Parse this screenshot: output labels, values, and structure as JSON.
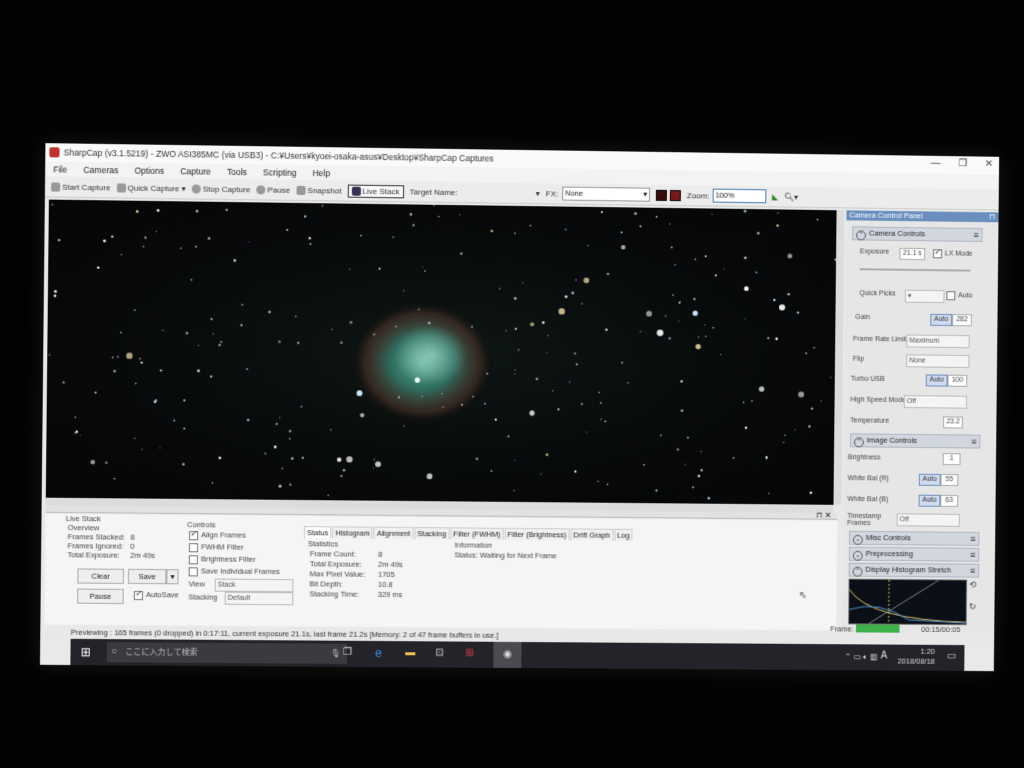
{
  "window": {
    "title": "SharpCap (v3.1.5219) - ZWO ASI385MC (via USB3) - C:¥Users¥kyoei-osaka-asus¥Desktop¥SharpCap Captures",
    "controls": [
      "—",
      "❐",
      "✕"
    ]
  },
  "menu": [
    "File",
    "Cameras",
    "Options",
    "Capture",
    "Tools",
    "Scripting",
    "Help"
  ],
  "toolbar": {
    "start_capture": "Start Capture",
    "quick_capture": "Quick Capture",
    "stop_capture": "Stop Capture",
    "pause": "Pause",
    "snapshot": "Snapshot",
    "live_stack": "Live Stack",
    "target_name_label": "Target Name:",
    "fx_label": "FX:",
    "fx_value": "None",
    "zoom_label": "Zoom:",
    "zoom_value": "100%"
  },
  "live_stack": {
    "title": "Live Stack",
    "overview_label": "Overview",
    "frames_stacked_label": "Frames Stacked:",
    "frames_stacked": "8",
    "frames_ignored_label": "Frames Ignored:",
    "frames_ignored": "0",
    "total_exposure_label": "Total Exposure:",
    "total_exposure": "2m 49s",
    "clear": "Clear",
    "save": "Save",
    "pause": "Pause",
    "autosave": "AutoSave",
    "controls_label": "Controls",
    "align_frames": "Align Frames",
    "fwhm_filter": "FWHM Filter",
    "brightness_filter": "Brightness Filter",
    "save_individual": "Save Individual Frames",
    "view_label": "View",
    "view_value": "Stack",
    "stacking_label": "Stacking",
    "stacking_value": "Default",
    "tabs": [
      "Status",
      "Histogram",
      "Alignment",
      "Stacking",
      "Filter (FWHM)",
      "Filter (Brightness)",
      "Drift Graph",
      "Log"
    ],
    "statistics_label": "Statistics",
    "stats": [
      {
        "label": "Frame Count:",
        "value": "8"
      },
      {
        "label": "Total Exposure:",
        "value": "2m 49s"
      },
      {
        "label": "Max Pixel Value:",
        "value": "1705"
      },
      {
        "label": "Bit Depth:",
        "value": "10.8"
      },
      {
        "label": "Stacking Time:",
        "value": "329 ms"
      }
    ],
    "information_label": "Information",
    "information_status": "Status: Waiting for Next Frame"
  },
  "statusbar": "Previewing : 165 frames (0 dropped) in 0:17:11, current exposure 21.1s, last frame 21.2s [Memory: 2 of 47 frame buffers in use.]",
  "panel": {
    "title": "Camera Control Panel",
    "camera_controls": "Camera Controls",
    "exposure_label": "Exposure",
    "exposure_value": "21.1 s",
    "lx_mode": "LX Mode",
    "quick_picks": "Quick Picks",
    "auto": "Auto",
    "gain_label": "Gain",
    "gain_value": "282",
    "frame_rate_label": "Frame Rate Limit",
    "frame_rate_value": "Maximum",
    "flip_label": "Flip",
    "flip_value": "None",
    "turbo_label": "Turbo USB",
    "turbo_value": "100",
    "high_speed_label": "High Speed Mode",
    "high_speed_value": "Off",
    "temperature_label": "Temperature",
    "temperature_value": "23.2",
    "image_controls": "Image Controls",
    "brightness_label": "Brightness",
    "brightness_value": "1",
    "wb_r_label": "White Bal (R)",
    "wb_r_value": "55",
    "wb_b_label": "White Bal (B)",
    "wb_b_value": "63",
    "timestamp_label": "Timestamp Frames",
    "timestamp_value": "Off",
    "misc_controls": "Misc Controls",
    "preprocessing": "Preprocessing",
    "display_histogram": "Display Histogram Stretch",
    "frame_label": "Frame:",
    "frame_time": "00:15/00:05"
  },
  "taskbar": {
    "search_placeholder": "ここに入力して検索",
    "time": "1:20",
    "date": "2018/08/18",
    "ime": "A"
  },
  "colors": {
    "panel_header": "#6a8fbf",
    "frame_progress": "#3db04a",
    "taskbar": "#23242a"
  }
}
